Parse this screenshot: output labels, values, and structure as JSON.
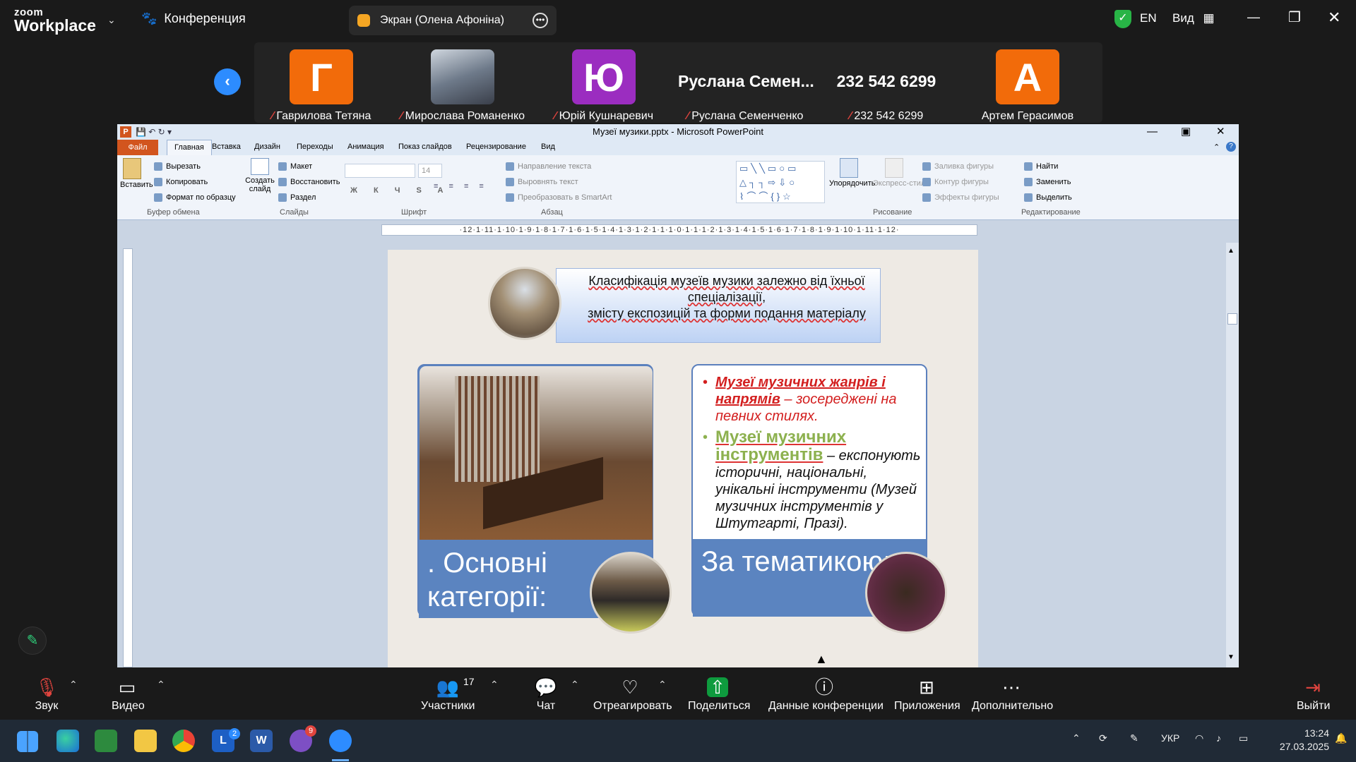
{
  "zoom": {
    "logo_top": "zoom",
    "logo_bottom": "Workplace",
    "meeting_label": "Конференция",
    "screen_share_label": "Экран (Олена Афоніна)",
    "language": "EN",
    "view_label": "Вид"
  },
  "participants": [
    {
      "initial": "Г",
      "name": "Гаврилова Тетяна",
      "color": "#f26b0a",
      "muted": true
    },
    {
      "initial": "",
      "name": "Мирослава Романенко",
      "muted": true,
      "video": true
    },
    {
      "initial": "Ю",
      "name": "Юрій Кушнаревич",
      "color": "#9b2dc0",
      "muted": true
    },
    {
      "display": "Руслана  Семен...",
      "name": "Руслана Семенченко",
      "muted": true
    },
    {
      "display": "232 542 6299",
      "name": "232 542 6299",
      "muted": true
    },
    {
      "initial": "А",
      "name": "Артем Герасимов",
      "color": "#f26b0a",
      "muted": false
    }
  ],
  "ppt": {
    "title": "Музеї музики.pptx - Microsoft PowerPoint",
    "tabs": [
      "Файл",
      "Главная",
      "Вставка",
      "Дизайн",
      "Переходы",
      "Анимация",
      "Показ слайдов",
      "Рецензирование",
      "Вид"
    ],
    "clipboard": {
      "paste": "Вставить",
      "cut": "Вырезать",
      "copy": "Копировать",
      "format": "Формат по образцу",
      "group": "Буфер обмена"
    },
    "slides": {
      "create": "Создать слайд",
      "layout": "Макет",
      "restore": "Восстановить",
      "section": "Раздел",
      "group": "Слайды"
    },
    "font": {
      "size": "14",
      "group": "Шрифт"
    },
    "paragraph": {
      "text_direction": "Направление текста",
      "align_text": "Выровнять текст",
      "smartart": "Преобразовать в SmartArt",
      "group": "Абзац"
    },
    "drawing": {
      "arrange": "Упорядочить",
      "quick_styles": "Экспресс-стили",
      "fill": "Заливка фигуры",
      "outline": "Контур фигуры",
      "effects": "Эффекты фигуры",
      "group": "Рисование"
    },
    "editing": {
      "find": "Найти",
      "replace": "Заменить",
      "select": "Выделить",
      "group": "Редактирование"
    },
    "ruler": "·12·1·11·1·10·1·9·1·8·1·7·1·6·1·5·1·4·1·3·1·2·1·1·1·0·1·1·1·2·1·3·1·4·1·5·1·6·1·7·1·8·1·9·1·10·1·11·1·12·"
  },
  "slide": {
    "heading_line1": "Класифікація музеїв музики залежно від їхньої спеціалізації,",
    "heading_line2": "змісту експозицій та форми подання матеріалу",
    "left_band": ". Основні категорії:",
    "right_band": "За тематикою:",
    "bullet1_title": "Музеї музичних жанрів і напрямів",
    "bullet1_desc": " – зосереджені на певних стилях.",
    "bullet2_title": "Музеї музичних інструментів",
    "bullet2_desc": " – експонують історичні, національні, унікальні інструменти (Музей музичних інструментів у Штутгарті, Празі)."
  },
  "toolbar": {
    "audio": "Звук",
    "video": "Видео",
    "participants": "Участники",
    "participants_count": "17",
    "chat": "Чат",
    "react": "Отреагировать",
    "share": "Поделиться",
    "info": "Данные конференции",
    "apps": "Приложения",
    "more": "Дополнительно",
    "leave": "Выйти"
  },
  "taskbar": {
    "lang": "УКР",
    "time": "13:24",
    "date": "27.03.2025",
    "badge_l": "2",
    "badge_viber": "9"
  }
}
